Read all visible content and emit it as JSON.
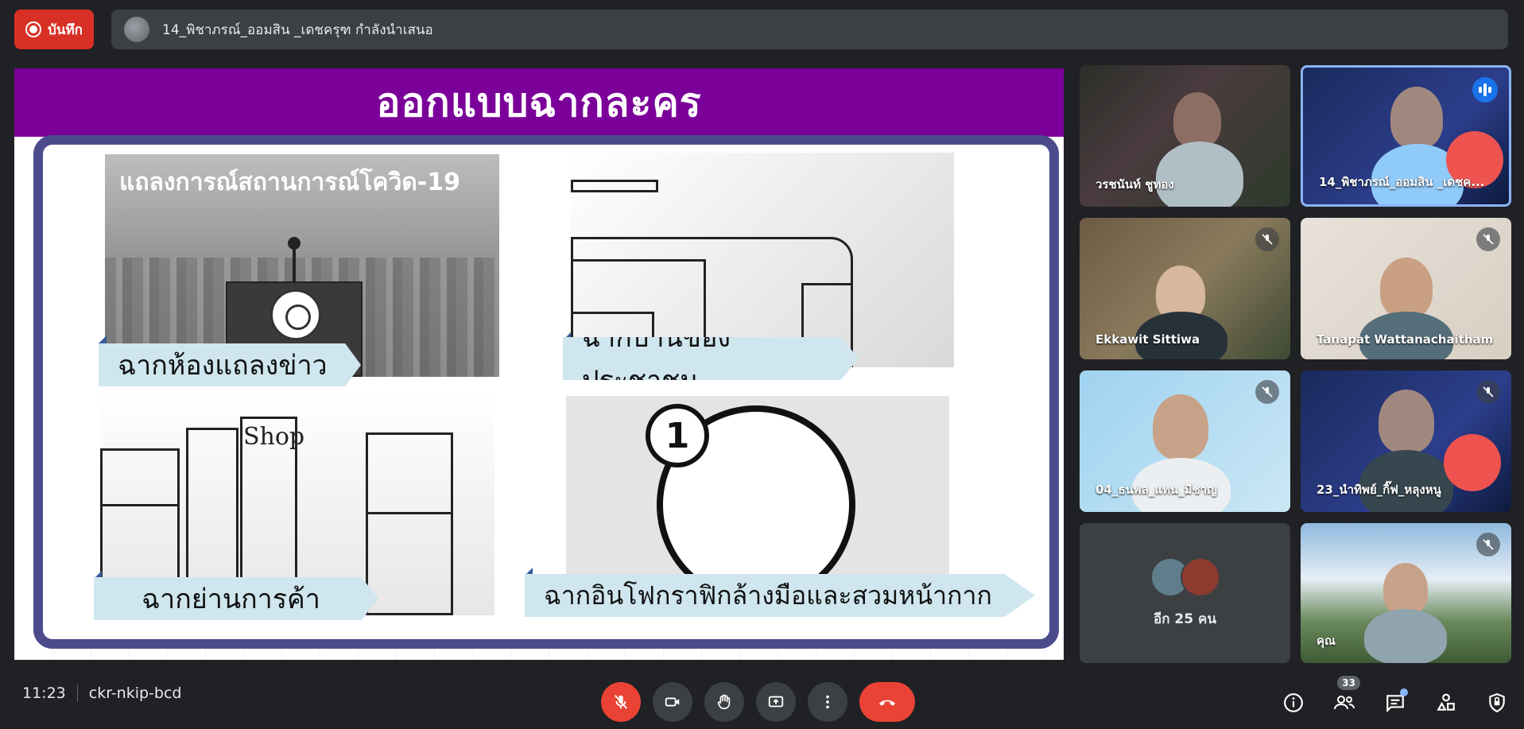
{
  "header": {
    "record_label": "บันทึก",
    "presenting_text": "14_พิชาภรณ์_ออมสิน _เดชครุฑ กำลังนำเสนอ"
  },
  "slide": {
    "title": "ออกแบบฉากละคร",
    "scenes": [
      {
        "caption": "ฉากห้องแถลงข่าว",
        "overlay_text": "แถลงการณ์สถานการณ์โควิด-19"
      },
      {
        "caption": "ฉากบ้านของประชาชน"
      },
      {
        "caption": "ฉากย่านการค้า",
        "overlay_text": "Shop"
      },
      {
        "caption": "ฉากอินโฟกราฟิกล้างมือและสวมหน้ากาก",
        "overlay_text": "1"
      }
    ]
  },
  "participants": [
    {
      "name": "วรชนันท์ ชูทอง",
      "muted": false,
      "speaking": false
    },
    {
      "name": "14_พิชาภรณ์_ออมสิน _เดชค...",
      "muted": false,
      "speaking": true
    },
    {
      "name": "Ekkawit Sittiwa",
      "muted": true
    },
    {
      "name": "Tanapat Wattanachaitham",
      "muted": true
    },
    {
      "name": "04_ธนพล_แทน_มีชาญ",
      "muted": true
    },
    {
      "name": "23_นำทิพย์_กิ๊ฟ_หลุงหนู",
      "muted": true
    },
    {
      "name": "คุณ",
      "muted": true
    }
  ],
  "others": {
    "label": "อีก 25 คน"
  },
  "footer": {
    "time": "11:23",
    "meeting_code": "ckr-nkip-bcd",
    "people_count": "33"
  },
  "icons": {
    "record": "record-icon",
    "mic": "mic-off-icon",
    "camera": "camera-icon",
    "hand": "raise-hand-icon",
    "present": "present-screen-icon",
    "more": "more-vert-icon",
    "end": "end-call-icon",
    "info": "info-icon",
    "people": "people-icon",
    "chat": "chat-icon",
    "activities": "activities-icon",
    "host": "host-controls-icon"
  },
  "colors": {
    "record_red": "#d93025",
    "end_call_red": "#ea4335",
    "slide_header_purple": "#7b0099",
    "frame_navy": "#4b4b8c",
    "caption_bg": "#cfe6ef",
    "active_speaker_blue": "#8ab4f8"
  }
}
